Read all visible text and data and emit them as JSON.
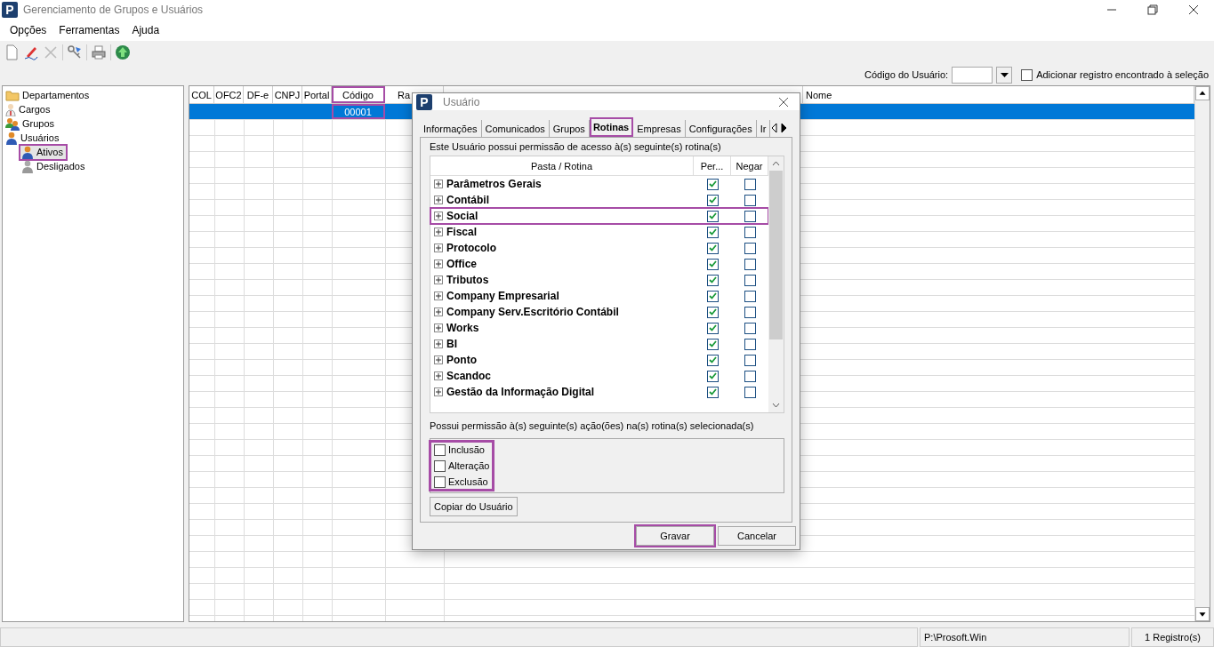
{
  "window": {
    "logo_letter": "P",
    "title": "Gerenciamento de Grupos e Usuários"
  },
  "menu": [
    "Opções",
    "Ferramentas",
    "Ajuda"
  ],
  "search": {
    "label": "Código do Usuário:",
    "add_checkbox": {
      "label": "Adicionar registro encontrado à seleção",
      "checked": false
    }
  },
  "tree": [
    {
      "label": "Departamentos",
      "kind": "folder",
      "selected": false
    },
    {
      "label": "Cargos",
      "kind": "role",
      "selected": false
    },
    {
      "label": "Grupos",
      "kind": "group",
      "selected": false
    },
    {
      "label": "Usuários",
      "kind": "user",
      "selected": false,
      "children": [
        {
          "label": "Ativos",
          "kind": "user",
          "selected": true,
          "highlighted": true
        },
        {
          "label": "Desligados",
          "kind": "user-off",
          "selected": false,
          "highlighted": false
        }
      ]
    }
  ],
  "grid": {
    "columns": [
      {
        "label": "COL",
        "highlighted": false
      },
      {
        "label": "OFC2",
        "highlighted": false
      },
      {
        "label": "DF-e",
        "highlighted": false
      },
      {
        "label": "CNPJ",
        "highlighted": false
      },
      {
        "label": "Portal",
        "highlighted": false
      },
      {
        "label": "Código",
        "highlighted": true
      },
      {
        "label": "Ra",
        "highlighted": false
      },
      {
        "label": "Nome",
        "highlighted": false
      }
    ],
    "rows": [
      {
        "selected": true,
        "code": "00001"
      }
    ]
  },
  "dialog": {
    "logo_letter": "P",
    "title": "Usuário",
    "tabs": [
      {
        "label": "Informações",
        "selected": false,
        "highlighted": false
      },
      {
        "label": "Comunicados",
        "selected": false,
        "highlighted": false
      },
      {
        "label": "Grupos",
        "selected": false,
        "highlighted": false
      },
      {
        "label": "Rotinas",
        "selected": true,
        "highlighted": true
      },
      {
        "label": "Empresas",
        "selected": false,
        "highlighted": false
      },
      {
        "label": "Configurações",
        "selected": false,
        "highlighted": false
      },
      {
        "label": "Ir",
        "selected": false,
        "highlighted": false
      }
    ],
    "routines_label": "Este Usuário possui permissão de acesso à(s) seguinte(s) rotina(s)",
    "routine_columns": [
      "Pasta / Rotina",
      "Per...",
      "Negar"
    ],
    "routines": [
      {
        "name": "Parâmetros Gerais",
        "permit": true,
        "deny": false,
        "highlighted": false
      },
      {
        "name": "Contábil",
        "permit": true,
        "deny": false,
        "highlighted": false
      },
      {
        "name": "Social",
        "permit": true,
        "deny": false,
        "highlighted": true
      },
      {
        "name": "Fiscal",
        "permit": true,
        "deny": false,
        "highlighted": false
      },
      {
        "name": "Protocolo",
        "permit": true,
        "deny": false,
        "highlighted": false
      },
      {
        "name": "Office",
        "permit": true,
        "deny": false,
        "highlighted": false
      },
      {
        "name": "Tributos",
        "permit": true,
        "deny": false,
        "highlighted": false
      },
      {
        "name": "Company Empresarial",
        "permit": true,
        "deny": false,
        "highlighted": false
      },
      {
        "name": "Company Serv.Escritório Contábil",
        "permit": true,
        "deny": false,
        "highlighted": false
      },
      {
        "name": "Works",
        "permit": true,
        "deny": false,
        "highlighted": false
      },
      {
        "name": "BI",
        "permit": true,
        "deny": false,
        "highlighted": false
      },
      {
        "name": "Ponto",
        "permit": true,
        "deny": false,
        "highlighted": false
      },
      {
        "name": "Scandoc",
        "permit": true,
        "deny": false,
        "highlighted": false
      },
      {
        "name": "Gestão da Informação Digital",
        "permit": true,
        "deny": false,
        "highlighted": false
      }
    ],
    "actions_label": "Possui permissão à(s) seguinte(s) ação(ões) na(s) rotina(s) selecionada(s)",
    "actions_highlighted": true,
    "actions": [
      {
        "label": "Inclusão",
        "checked": false
      },
      {
        "label": "Alteração",
        "checked": false
      },
      {
        "label": "Exclusão",
        "checked": false
      }
    ],
    "copy_button": "Copiar do Usuário",
    "buttons": [
      {
        "label": "Gravar",
        "highlighted": true
      },
      {
        "label": "Cancelar",
        "highlighted": false
      }
    ]
  },
  "status_bar": [
    "P:\\Prosoft.Win",
    "1 Registro(s)"
  ]
}
